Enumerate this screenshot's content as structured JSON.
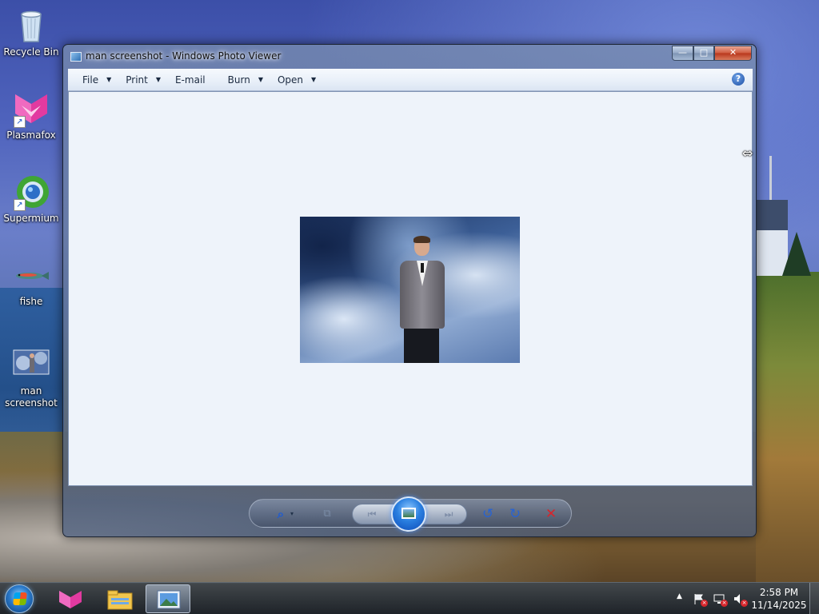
{
  "desktop": {
    "icons": [
      {
        "label": "Recycle Bin",
        "icon": "recycle-bin-icon"
      },
      {
        "label": "Plasmafox",
        "icon": "plasmafox-icon"
      },
      {
        "label": "Supermium",
        "icon": "supermium-icon"
      },
      {
        "label": "fishe",
        "icon": "fish-icon"
      },
      {
        "label": "man screenshot",
        "icon": "image-file-icon"
      }
    ]
  },
  "window": {
    "title": "man screenshot - Windows Photo Viewer",
    "caption_buttons": {
      "minimize": "—",
      "maximize": "□",
      "close": "✕"
    },
    "menu": [
      {
        "label": "File",
        "has_dropdown": true
      },
      {
        "label": "Print",
        "has_dropdown": true
      },
      {
        "label": "E-mail",
        "has_dropdown": false
      },
      {
        "label": "Burn",
        "has_dropdown": true
      },
      {
        "label": "Open",
        "has_dropdown": true
      }
    ],
    "help": "?",
    "toolbar": {
      "zoom": "⌕",
      "zoom_caret": "▾",
      "actual_size": "⧉",
      "previous": "⏮",
      "next": "⏭",
      "rotate_left": "↺",
      "rotate_right": "↻",
      "delete": "✕"
    }
  },
  "taskbar": {
    "pinned": [
      "plasmafox-icon",
      "file-explorer-icon",
      "photo-viewer-icon"
    ],
    "active": "photo-viewer-icon",
    "tray": {
      "expand": "▲",
      "time": "2:58 PM",
      "date": "11/14/2025"
    }
  },
  "colors": {
    "accent": "#1d5bd4",
    "close": "#d6252c"
  }
}
